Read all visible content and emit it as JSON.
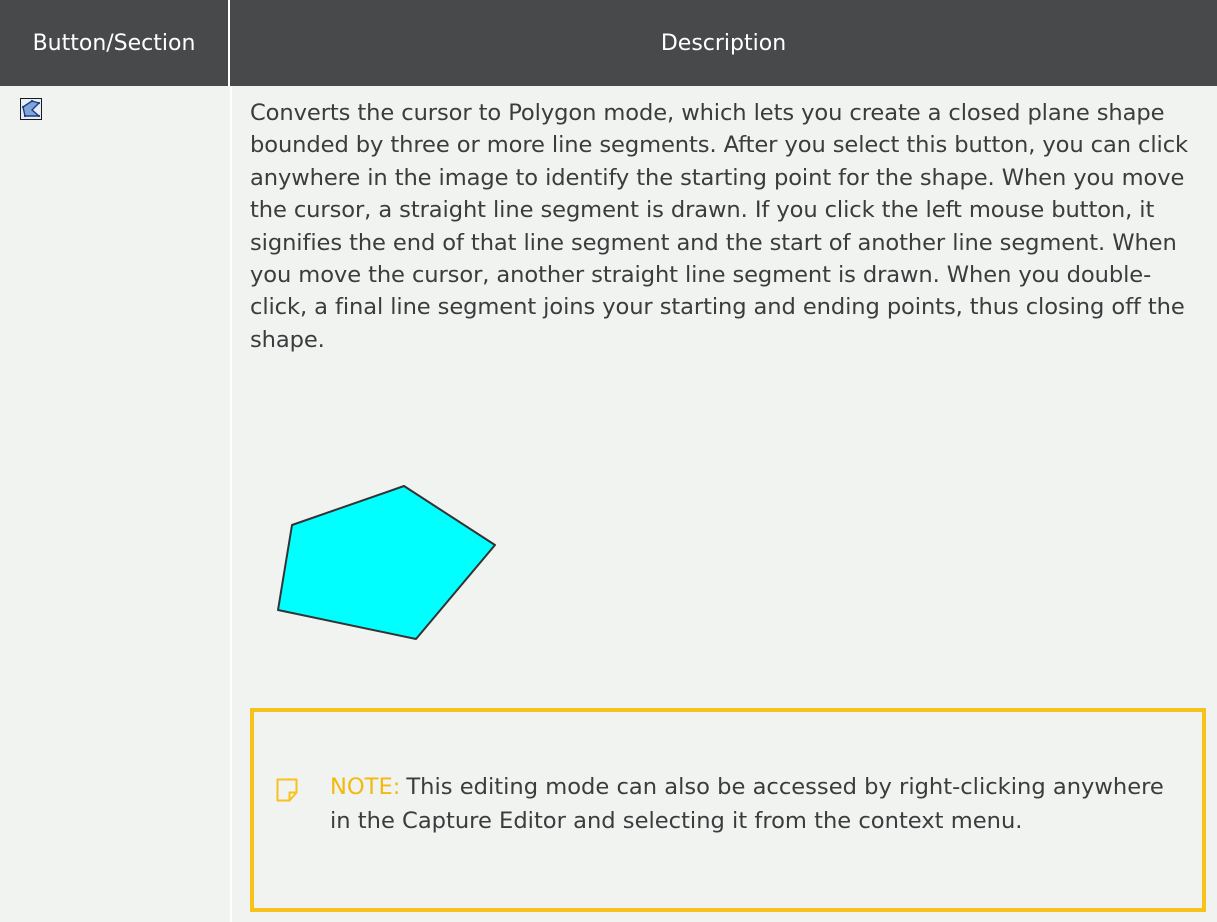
{
  "table": {
    "headers": {
      "button_section": "Button/Section",
      "description": "Description"
    },
    "row": {
      "button_icon": "polygon-tool-icon",
      "description": "Converts the cursor to Polygon mode, which lets you create a closed plane shape bounded by three or more line segments. After you select this button, you can click anywhere in the image to identify the starting point for the shape. When you move the cursor, a straight line segment is drawn. If you click the left mouse button, it signifies the end of that line segment and the start of another line segment. When you move the cursor, another straight line segment is drawn. When you double-click, a final line segment joins your starting and ending points, thus closing off the shape.",
      "figure": {
        "shape": "pentagon",
        "fill_color": "#00ffff",
        "stroke_color": "#333333"
      },
      "note": {
        "icon": "note-icon",
        "label": "NOTE:",
        "text": "This editing mode can also be accessed by right-clicking anywhere in the Capture Editor and selecting it from the context menu.",
        "accent_color": "#f7c21a"
      }
    }
  },
  "colors": {
    "header_background": "#47494a",
    "header_text": "#ffffff",
    "body_background": "#f1f3f1",
    "body_text": "#3a3c3d"
  }
}
